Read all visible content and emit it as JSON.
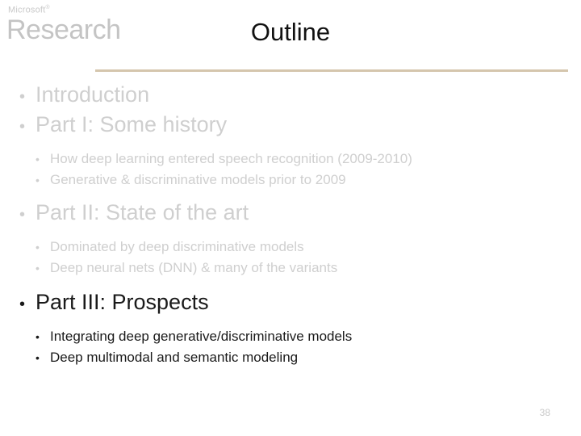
{
  "logo": {
    "top": "Microsoft",
    "top_sup": "®",
    "main": "Research"
  },
  "title": "Outline",
  "colors": {
    "divider": "#d5c6ad",
    "muted_text": "#cfcfcf",
    "dark_text": "#1a1a1a",
    "logo_gray": "#c4c4c4",
    "page_number": "#c9c9c9"
  },
  "bullets": {
    "level1": "•",
    "level2": "•"
  },
  "outline": [
    {
      "level": 1,
      "text": "Introduction",
      "emphasis": "muted"
    },
    {
      "level": 1,
      "text": "Part I: Some history",
      "emphasis": "muted"
    },
    {
      "level": 2,
      "text": "How deep learning entered speech recognition (2009-2010)",
      "emphasis": "muted"
    },
    {
      "level": 2,
      "text": "Generative & discriminative models prior to 2009",
      "emphasis": "muted"
    },
    {
      "level": 1,
      "text": "Part II: State of the art",
      "emphasis": "muted"
    },
    {
      "level": 2,
      "text": "Dominated by deep discriminative models",
      "emphasis": "muted"
    },
    {
      "level": 2,
      "text": "Deep neural nets (DNN) & many of the variants",
      "emphasis": "muted"
    },
    {
      "level": 1,
      "text": "Part III: Prospects",
      "emphasis": "dark"
    },
    {
      "level": 2,
      "text": "Integrating deep generative/discriminative models",
      "emphasis": "dark"
    },
    {
      "level": 2,
      "text": "Deep multimodal and semantic modeling",
      "emphasis": "dark"
    }
  ],
  "page_number": "38"
}
